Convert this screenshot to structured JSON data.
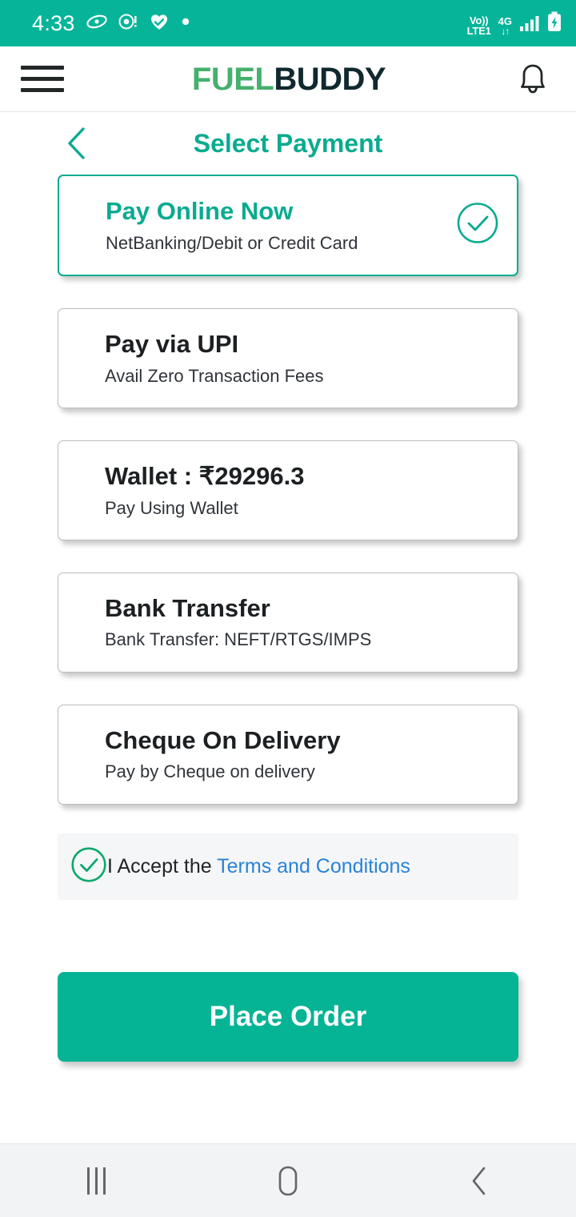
{
  "status_bar": {
    "time": "4:33",
    "left_icons": [
      "eye-icon",
      "record-icon",
      "heart-health-icon",
      "dot-icon"
    ],
    "volte_top": "Vo))",
    "volte_bottom": "LTE1",
    "network_label": "4G",
    "network_arrows": "↓↑",
    "right_icons": [
      "signal-bars-icon",
      "battery-charging-icon"
    ],
    "background_color": "#06b499"
  },
  "header": {
    "menu_icon": "hamburger-icon",
    "logo": {
      "part1": "F",
      "part_u": "U",
      "part2": "EL",
      "part3": "BUDDY",
      "green": "#45b06c",
      "dark": "#10292e"
    },
    "notification_icon": "bell-icon"
  },
  "page": {
    "back_icon": "chevron-left-icon",
    "title": "Select Payment",
    "title_color": "#0aab8f"
  },
  "payment_methods": [
    {
      "title": "Pay Online Now",
      "subtitle": "NetBanking/Debit or Credit Card",
      "selected": true,
      "check_icon": "circle-check-icon"
    },
    {
      "title": "Pay via UPI",
      "subtitle": "Avail Zero Transaction Fees",
      "selected": false
    },
    {
      "title": "Wallet : ₹29296.3",
      "subtitle": "Pay Using Wallet",
      "selected": false
    },
    {
      "title": "Bank Transfer",
      "subtitle": "Bank Transfer: NEFT/RTGS/IMPS",
      "selected": false
    },
    {
      "title": "Cheque On Delivery",
      "subtitle": "Pay by Cheque on delivery",
      "selected": false
    }
  ],
  "terms": {
    "check_icon": "circle-check-icon",
    "accept_text": "I Accept the ",
    "link_text": "Terms and Conditions",
    "link_color": "#2a82da",
    "checked": true
  },
  "place_order": {
    "label": "Place Order",
    "color": "#05b495"
  },
  "nav_bar": {
    "recents_icon": "recents-icon",
    "home_icon": "home-icon",
    "back_icon": "back-chevron-icon"
  }
}
